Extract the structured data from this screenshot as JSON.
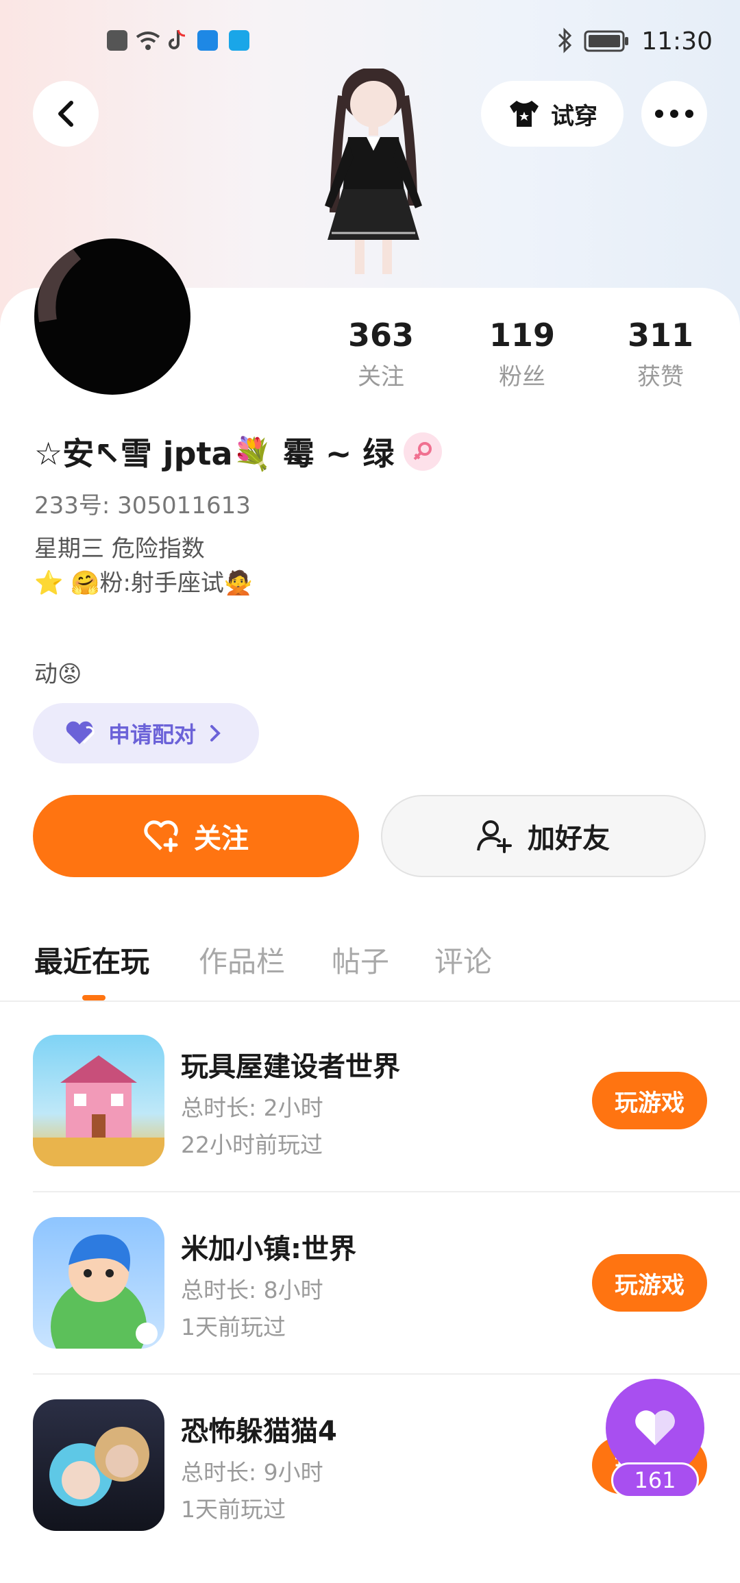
{
  "status_bar": {
    "time": "11:30"
  },
  "header": {
    "try_on_label": "试穿"
  },
  "profile": {
    "stats": [
      {
        "value": "363",
        "label": "关注"
      },
      {
        "value": "119",
        "label": "粉丝"
      },
      {
        "value": "311",
        "label": "获赞"
      }
    ],
    "name": "☆安↖雪 jpta💐 霉 ~ 绿",
    "uid": "233号: 305011613",
    "bio_lines": "星期三  危险指数\n ⭐ 🤗粉:射手座试🙅",
    "bio_extra": "动😡",
    "pair_label": "申请配对"
  },
  "actions": {
    "follow_label": "关注",
    "add_friend_label": "加好友"
  },
  "tabs": [
    {
      "label": "最近在玩"
    },
    {
      "label": "作品栏"
    },
    {
      "label": "帖子"
    },
    {
      "label": "评论"
    }
  ],
  "games": [
    {
      "title": "玩具屋建设者世界",
      "duration": "总时长: 2小时",
      "last_played": "22小时前玩过",
      "button": "玩游戏"
    },
    {
      "title": "米加小镇:世界",
      "duration": "总时长: 8小时",
      "last_played": "1天前玩过",
      "button": "玩游戏"
    },
    {
      "title": "恐怖躲猫猫4",
      "duration": "总时长: 9小时",
      "last_played": "1天前玩过",
      "button": "玩游戏"
    }
  ],
  "floating_like": {
    "count": "161"
  },
  "colors": {
    "accent": "#ff7411",
    "pair_bg": "#ecebfb",
    "pair_text": "#6b62d8",
    "like_purple": "#a84ff0"
  }
}
